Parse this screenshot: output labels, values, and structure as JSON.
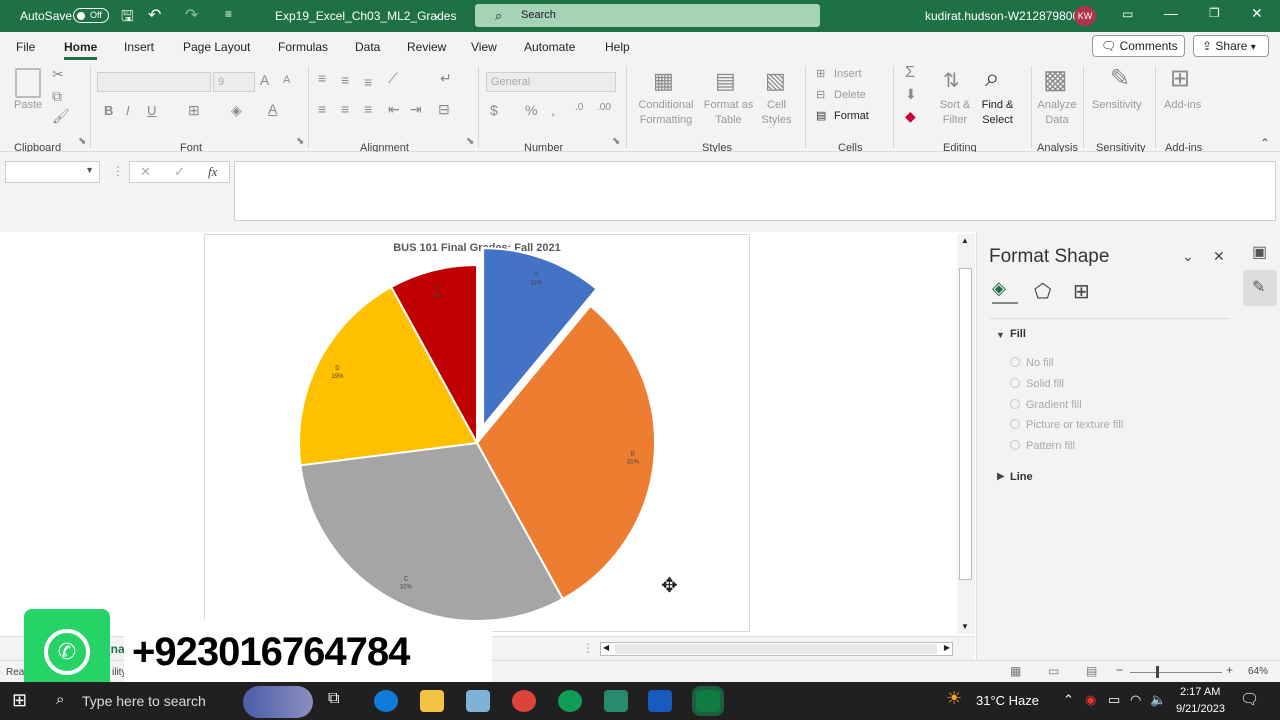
{
  "titlebar": {
    "autosave": "AutoSave",
    "autosave_state": "Off",
    "doc_title": "Exp19_Excel_Ch03_ML2_Grades",
    "search_placeholder": "Search",
    "user": "kudirat.hudson-W212879806",
    "initials": "KW"
  },
  "menu": {
    "tabs": [
      "File",
      "Home",
      "Insert",
      "Page Layout",
      "Formulas",
      "Data",
      "Review",
      "View",
      "Automate",
      "Help"
    ],
    "comments": "Comments",
    "share": "Share"
  },
  "ribbon": {
    "clipboard": {
      "paste": "Paste",
      "group": "Clipboard"
    },
    "font": {
      "size": "9",
      "group": "Font"
    },
    "alignment": {
      "group": "Alignment"
    },
    "number": {
      "format": "General",
      "group": "Number"
    },
    "styles": {
      "conditional": "Conditional Formatting",
      "format_table": "Format as Table",
      "cell_styles": "Cell Styles",
      "group": "Styles"
    },
    "cells": {
      "insert": "Insert",
      "delete": "Delete",
      "format": "Format",
      "group": "Cells"
    },
    "editing": {
      "sort": "Sort & Filter",
      "find": "Find & Select",
      "group": "Editing"
    },
    "analysis": {
      "analyze": "Analyze Data",
      "group": "Analysis"
    },
    "sensitivity": {
      "label": "Sensitivity",
      "group": "Sensitivity"
    },
    "addins": {
      "label": "Add-ins",
      "group": "Add-ins"
    }
  },
  "formula_bar": {
    "fx": "fx"
  },
  "chart_data": {
    "type": "pie",
    "title": "BUS 101 Final Grades: Fall 2021",
    "categories": [
      "A",
      "B",
      "C",
      "D",
      "F"
    ],
    "values": [
      11,
      31,
      31,
      19,
      8
    ],
    "labels": [
      "A 11%",
      "B 31%",
      "C 31%",
      "D 19%",
      "F 8%"
    ],
    "colors": [
      "#4472c4",
      "#ed7d31",
      "#a5a5a5",
      "#ffc000",
      "#c00000"
    ],
    "exploded": "A"
  },
  "panel": {
    "title": "Format Shape",
    "fill_header": "Fill",
    "fill_options": [
      "No fill",
      "Solid fill",
      "Gradient fill",
      "Picture or texture fill",
      "Pattern fill"
    ],
    "line_header": "Line"
  },
  "status": {
    "ready": "Rea",
    "accessibility": "ility.",
    "zoom": "64%",
    "sheet_tab": "Fina"
  },
  "overlay": {
    "phone": "+923016764784"
  },
  "taskbar": {
    "search": "Type here to search",
    "weather": "31°C  Haze",
    "time": "2:17 AM",
    "date": "9/21/2023"
  }
}
